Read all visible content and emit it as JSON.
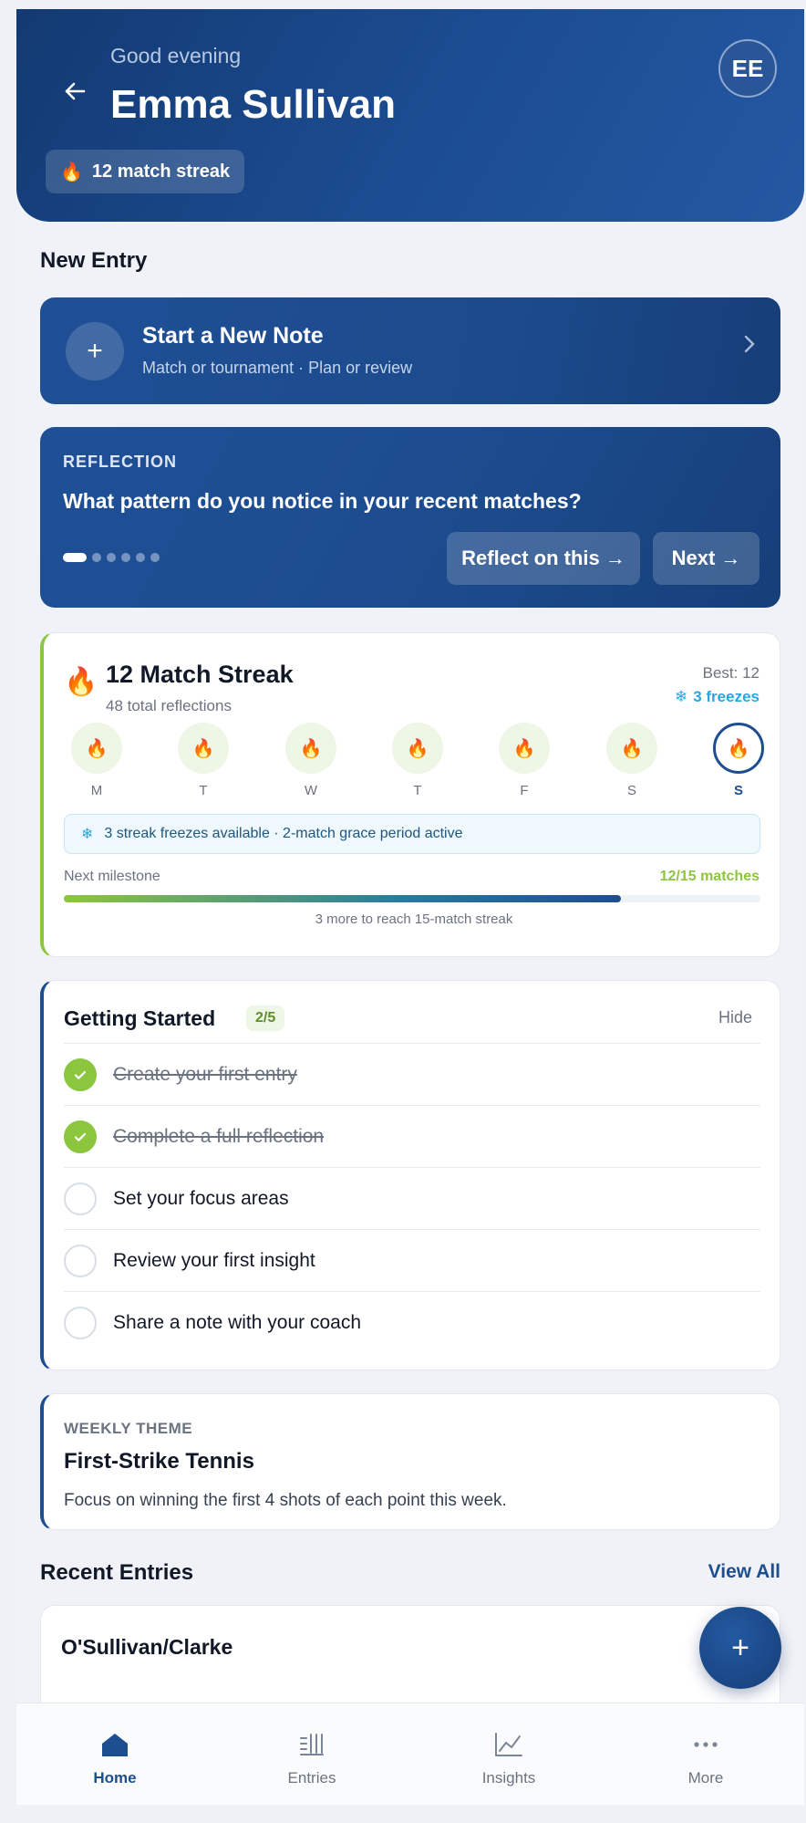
{
  "header": {
    "greeting": "Good evening",
    "name": "Emma Sullivan",
    "avatar_initials": "EE",
    "streak_pill": "12 match streak"
  },
  "new_entry": {
    "section_title": "New Entry",
    "title": "Start a New Note",
    "subtitle": "Match or tournament · Plan or review"
  },
  "reflection": {
    "label": "REFLECTION",
    "question": "What pattern do you notice in your recent matches?",
    "page_count": 6,
    "active_page": 1,
    "reflect_button": "Reflect on this →",
    "next_button": "Next →"
  },
  "streak": {
    "title": "12 Match Streak",
    "subtitle": "48 total reflections",
    "best": "Best: 12",
    "freezes": "3 freezes",
    "days": [
      "M",
      "T",
      "W",
      "T",
      "F",
      "S",
      "S"
    ],
    "freeze_note": "3 streak freezes available · 2-match grace period active",
    "milestone_label": "Next milestone",
    "milestone_count": "12/15 matches",
    "milestone_progress": 0.8,
    "milestone_hint": "3 more to reach 15-match streak"
  },
  "getting_started": {
    "title": "Getting Started",
    "badge": "2/5",
    "hide": "Hide",
    "items": [
      {
        "label": "Create your first entry",
        "done": true
      },
      {
        "label": "Complete a full reflection",
        "done": true
      },
      {
        "label": "Set your focus areas",
        "done": false
      },
      {
        "label": "Review your first insight",
        "done": false
      },
      {
        "label": "Share a note with your coach",
        "done": false
      }
    ]
  },
  "weekly_theme": {
    "label": "WEEKLY THEME",
    "title": "First-Strike Tennis",
    "description": "Focus on winning the first 4 shots of each point this week."
  },
  "recent": {
    "title": "Recent Entries",
    "view_all": "View All",
    "first_entry": "O'Sullivan/Clarke"
  },
  "nav": {
    "items": [
      {
        "label": "Home",
        "icon": "home-icon",
        "active": true
      },
      {
        "label": "Entries",
        "icon": "entries-icon",
        "active": false
      },
      {
        "label": "Insights",
        "icon": "insights-icon",
        "active": false
      },
      {
        "label": "More",
        "icon": "more-icon",
        "active": false
      }
    ]
  },
  "colors": {
    "brand": "#1d4e8f",
    "accent_green": "#8cc63f",
    "freeze_blue": "#26a7df"
  }
}
